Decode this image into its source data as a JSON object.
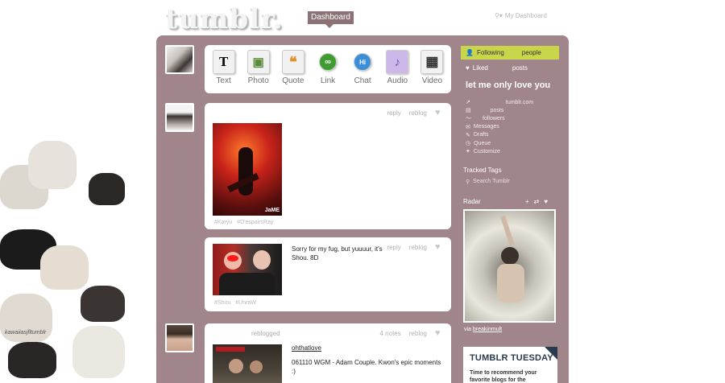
{
  "header": {
    "logo": "tumblr.",
    "dashboard_label": "Dashboard",
    "search_placeholder": "My Dashboard"
  },
  "composer": {
    "types": [
      {
        "label": "Text",
        "icon": "text-icon",
        "glyph": "T"
      },
      {
        "label": "Photo",
        "icon": "photo-icon",
        "glyph": "▣"
      },
      {
        "label": "Quote",
        "icon": "quote-icon",
        "glyph": "❝"
      },
      {
        "label": "Link",
        "icon": "link-icon",
        "glyph": "∞"
      },
      {
        "label": "Chat",
        "icon": "chat-icon",
        "glyph": "Hi"
      },
      {
        "label": "Audio",
        "icon": "audio-icon",
        "glyph": "♪"
      },
      {
        "label": "Video",
        "icon": "video-icon",
        "glyph": "▦"
      }
    ]
  },
  "posts": [
    {
      "reply": "reply",
      "reblog": "reblog",
      "image_caption": "JaME",
      "tags": [
        "#Karyu",
        "#D'espairsRay"
      ]
    },
    {
      "text": "Sorry for my fug, but yuuuur, it's Shou. 8D",
      "reply": "reply",
      "reblog": "reblog",
      "tags": [
        "#Shou",
        "#UnraW"
      ]
    },
    {
      "reblogged": "reblogged",
      "notes": "4 notes",
      "reblog": "reblog",
      "source_user": "ohthatlove",
      "text": "061110 WGM - Adam Couple. Kwon's epic moments :)"
    }
  ],
  "sidebar": {
    "following": "Following",
    "following_people": "people",
    "liked": "Liked",
    "liked_posts": "posts",
    "blog_title": "let me only love you",
    "links": [
      {
        "icon": "external-link-icon",
        "label": "tumblr.com",
        "indent": true
      },
      {
        "icon": "posts-icon",
        "label": "posts",
        "indent": true
      },
      {
        "icon": "followers-icon",
        "label": "followers",
        "indent": true
      },
      {
        "icon": "messages-icon",
        "label": "Messages",
        "indent": false
      },
      {
        "icon": "drafts-icon",
        "label": "Drafts",
        "indent": false
      },
      {
        "icon": "queue-icon",
        "label": "Queue",
        "indent": false
      },
      {
        "icon": "customize-icon",
        "label": "Customize",
        "indent": false
      }
    ],
    "tracked_tags": "Tracked Tags",
    "search_tumblr": "Search Tumblr",
    "radar": "Radar",
    "radar_via_prefix": "via",
    "radar_via_user": "breakinmult",
    "tumblr_tuesday": {
      "title": "TUMBLR TUESDAY",
      "body": "Time to recommend your favorite blogs for the"
    }
  },
  "background": {
    "caption": "kawaiiasjfltumblr"
  }
}
